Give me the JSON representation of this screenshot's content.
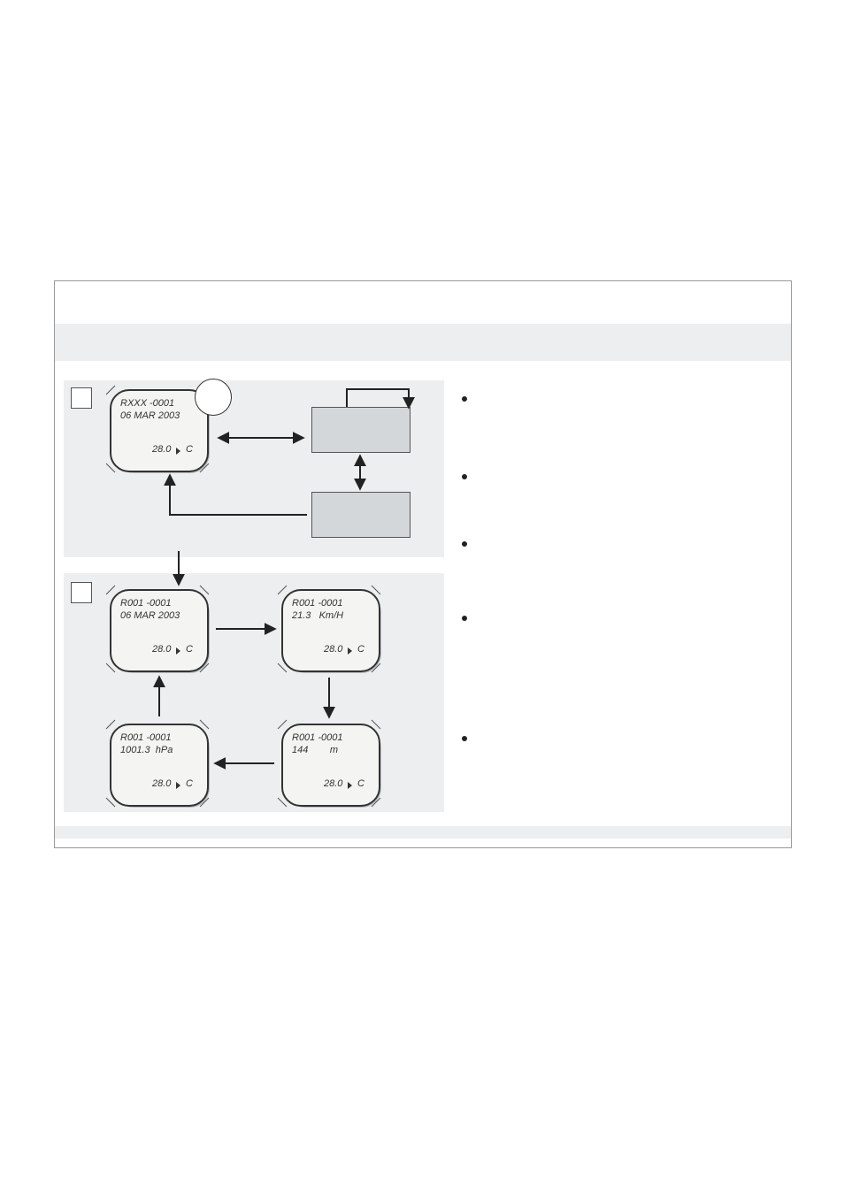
{
  "screens": {
    "top": {
      "line1": "RXXX  -0001",
      "line2": "06 MAR 2003",
      "temp_value": "28.0",
      "temp_unit": "C"
    },
    "r1": {
      "line1": "R001 -0001",
      "line2": "06 MAR 2003",
      "temp_value": "28.0",
      "temp_unit": "C"
    },
    "r2": {
      "line1": "R001 -0001",
      "value": "21.3",
      "unit": "Km/H",
      "temp_value": "28.0",
      "temp_unit": "C"
    },
    "r3": {
      "line1": "R001 -0001",
      "value": "144",
      "unit": "m",
      "temp_value": "28.0",
      "temp_unit": "C"
    },
    "r4": {
      "line1": "R001 -0001",
      "value": "1001.3",
      "unit": "hPa",
      "temp_value": "28.0",
      "temp_unit": "C"
    }
  }
}
